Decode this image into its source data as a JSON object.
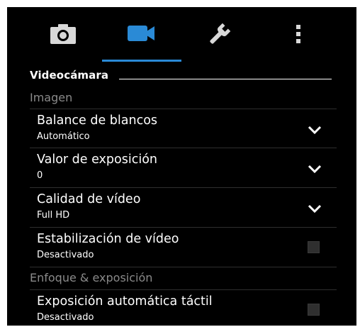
{
  "tabs": [
    {
      "icon": "camera-icon",
      "active": false
    },
    {
      "icon": "video-camera-icon",
      "active": true
    },
    {
      "icon": "wrench-icon",
      "active": false
    },
    {
      "icon": "more-vertical-icon",
      "active": false
    }
  ],
  "section_title": "Videocámara",
  "categories": {
    "image": "Imagen",
    "focus": "Enfoque & exposición"
  },
  "settings": {
    "white_balance": {
      "title": "Balance de blancos",
      "value": "Automático",
      "control": "dropdown"
    },
    "exposure": {
      "title": "Valor de exposición",
      "value": "0",
      "control": "dropdown"
    },
    "video_quality": {
      "title": "Calidad de vídeo",
      "value": "Full HD",
      "control": "dropdown"
    },
    "stabilization": {
      "title": "Estabilización de vídeo",
      "value": "Desactivado",
      "control": "checkbox",
      "checked": false
    },
    "touch_exposure": {
      "title": "Exposición automática táctil",
      "value": "Desactivado",
      "control": "checkbox",
      "checked": false
    }
  },
  "colors": {
    "background": "#000000",
    "accent": "#2a8ad6",
    "category_text": "#8a8a8a",
    "text": "#ffffff"
  }
}
